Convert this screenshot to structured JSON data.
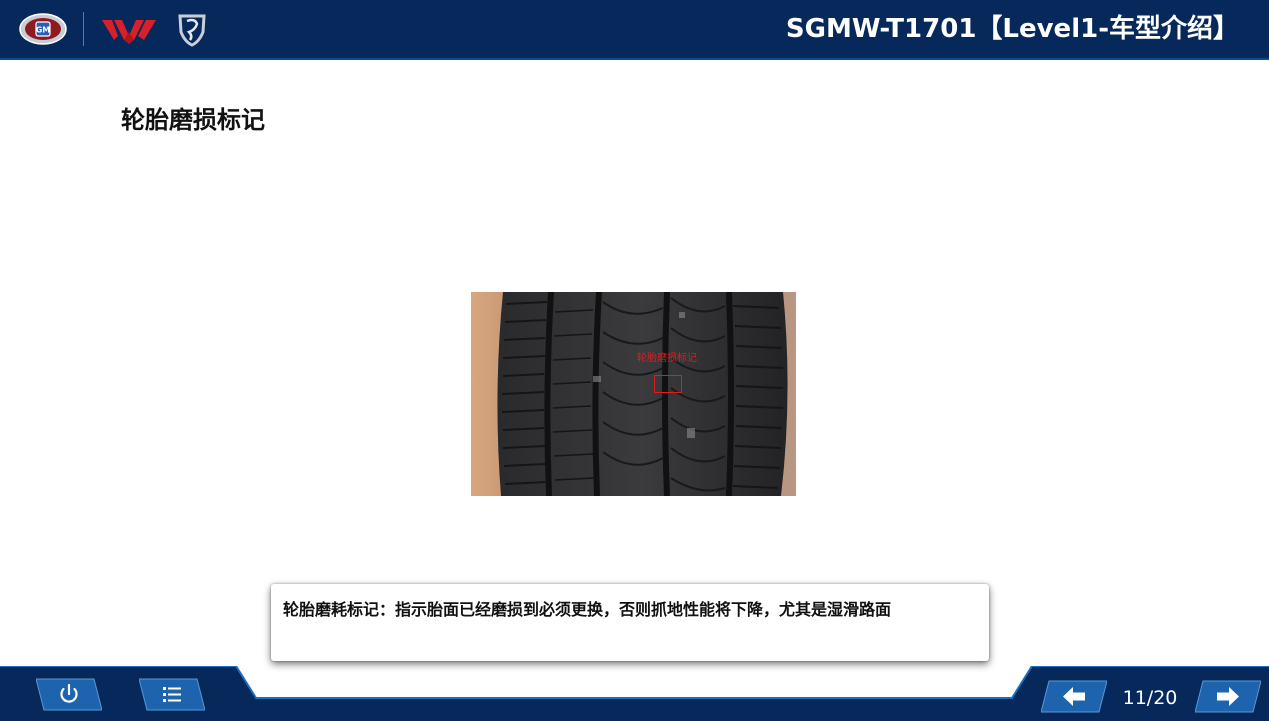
{
  "header": {
    "course_title": "SGMW-T1701【Level1-车型介绍】",
    "logos": [
      "gm-logo",
      "wuling-logo",
      "baojun-logo"
    ]
  },
  "page": {
    "title": "轮胎磨损标记",
    "photo_label": "轮胎磨损标记",
    "caption": "轮胎磨耗标记：指示胎面已经磨损到必须更换，否则抓地性能将下降，尤其是湿滑路面"
  },
  "footer": {
    "page_indicator": "11/20",
    "buttons": [
      "power-icon",
      "menu-list-icon",
      "arrow-left-icon",
      "arrow-right-icon"
    ]
  },
  "colors": {
    "header_bg": "#06285a",
    "footer_bg": "#06285a",
    "accent_blue": "#1a6fc2",
    "marker_red": "#e01c1c"
  }
}
